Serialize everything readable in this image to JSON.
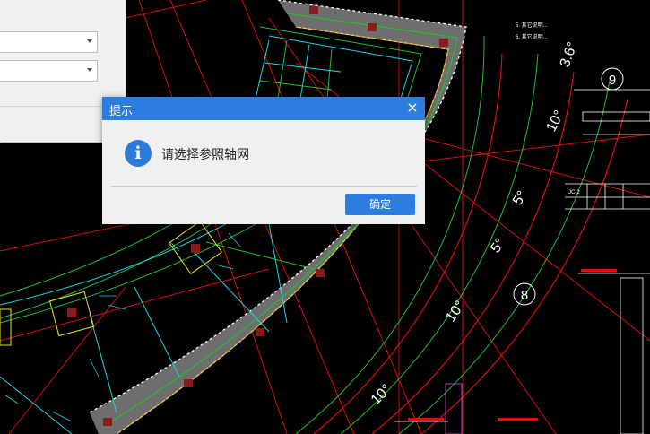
{
  "dialog": {
    "title": "提示",
    "close_glyph": "×",
    "icon": "info-icon",
    "message": "请选择参照轴网",
    "ok_label": "确定"
  },
  "drawing": {
    "axis_labels": [
      "9",
      "8"
    ],
    "angle_labels": [
      "3.6°",
      "10°",
      "5°",
      "5°",
      "10°",
      "10°"
    ],
    "column_labels": [
      "JC-2"
    ],
    "notes": [
      "5. 其它说明...",
      "6. 其它说明..."
    ]
  },
  "colors": {
    "accent": "#2d7de0",
    "cad_background": "#000000",
    "beam_fill": "#6e6e6e",
    "grid_red": "#e01010",
    "grid_green": "#22c032",
    "cyan": "#1ad6e6",
    "yellow": "#e6e61a"
  }
}
